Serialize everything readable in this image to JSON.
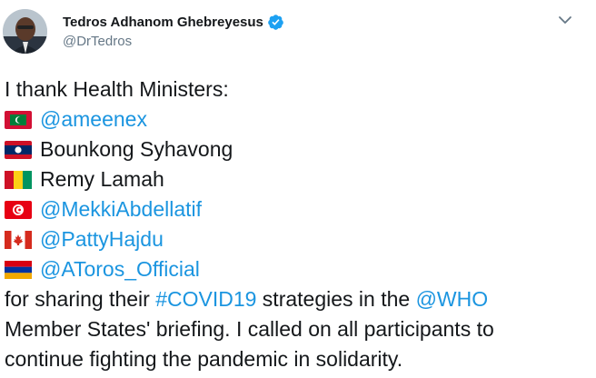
{
  "author": {
    "name": "Tedros Adhanom Ghebreyesus",
    "handle": "@DrTedros",
    "verified": true
  },
  "icons": {
    "verified": "verified-badge-icon",
    "menu": "chevron-down-icon"
  },
  "colors": {
    "link": "#1b95e0",
    "text": "#14171a",
    "secondary": "#657786",
    "verified": "#1da1f2"
  },
  "tweet": {
    "intro": "I thank Health Ministers:",
    "ministers": [
      {
        "flag": "maldives-flag-icon",
        "text": "@ameenex",
        "is_link": true
      },
      {
        "flag": "laos-flag-icon",
        "text": "Bounkong Syhavong",
        "is_link": false
      },
      {
        "flag": "guinea-flag-icon",
        "text": "Remy Lamah",
        "is_link": false
      },
      {
        "flag": "tunisia-flag-icon",
        "text": "@MekkiAbdellatif",
        "is_link": true
      },
      {
        "flag": "canada-flag-icon",
        "text": "@PattyHajdu",
        "is_link": true
      },
      {
        "flag": "armenia-flag-icon",
        "text": "@AToros_Official",
        "is_link": true
      }
    ],
    "closing": {
      "line1_pre": "for sharing their ",
      "hashtag": "#COVID19",
      "line1_mid": " strategies in the ",
      "mention": "@WHO",
      "line2": "Member States' briefing. I called on all participants to",
      "line3": "continue fighting the pandemic in solidarity."
    }
  }
}
